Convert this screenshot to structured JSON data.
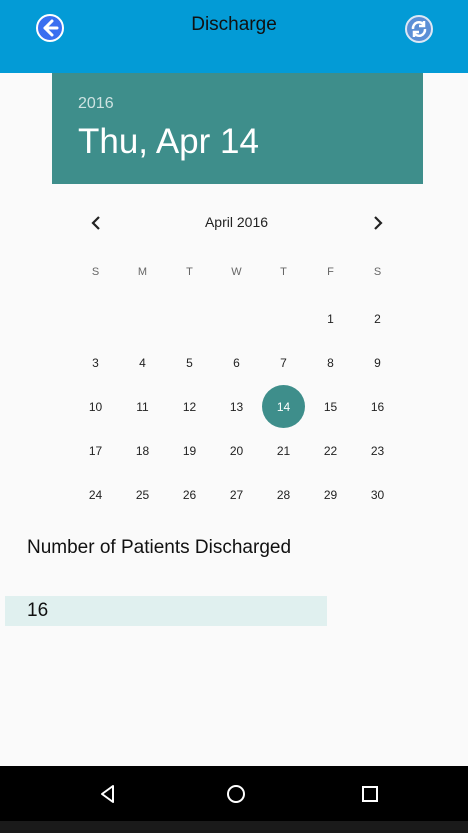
{
  "appbar": {
    "title": "Discharge",
    "back_icon": "back-arrow-icon",
    "refresh_icon": "refresh-icon",
    "color": "#039bd6"
  },
  "date_header": {
    "year": "2016",
    "date": "Thu, Apr 14",
    "color": "#3e8e8b"
  },
  "calendar": {
    "month_label": "April 2016",
    "prev_icon": "chevron-left-icon",
    "next_icon": "chevron-right-icon",
    "weekdays": [
      "S",
      "M",
      "T",
      "W",
      "T",
      "F",
      "S"
    ],
    "leading_blanks": 5,
    "days_in_month": 30,
    "selected_day": 14
  },
  "patients": {
    "label": "Number of Patients Discharged",
    "value": "16"
  },
  "navbar": {
    "back_icon": "nav-back-triangle-icon",
    "home_icon": "nav-home-circle-icon",
    "recents_icon": "nav-recents-square-icon"
  }
}
